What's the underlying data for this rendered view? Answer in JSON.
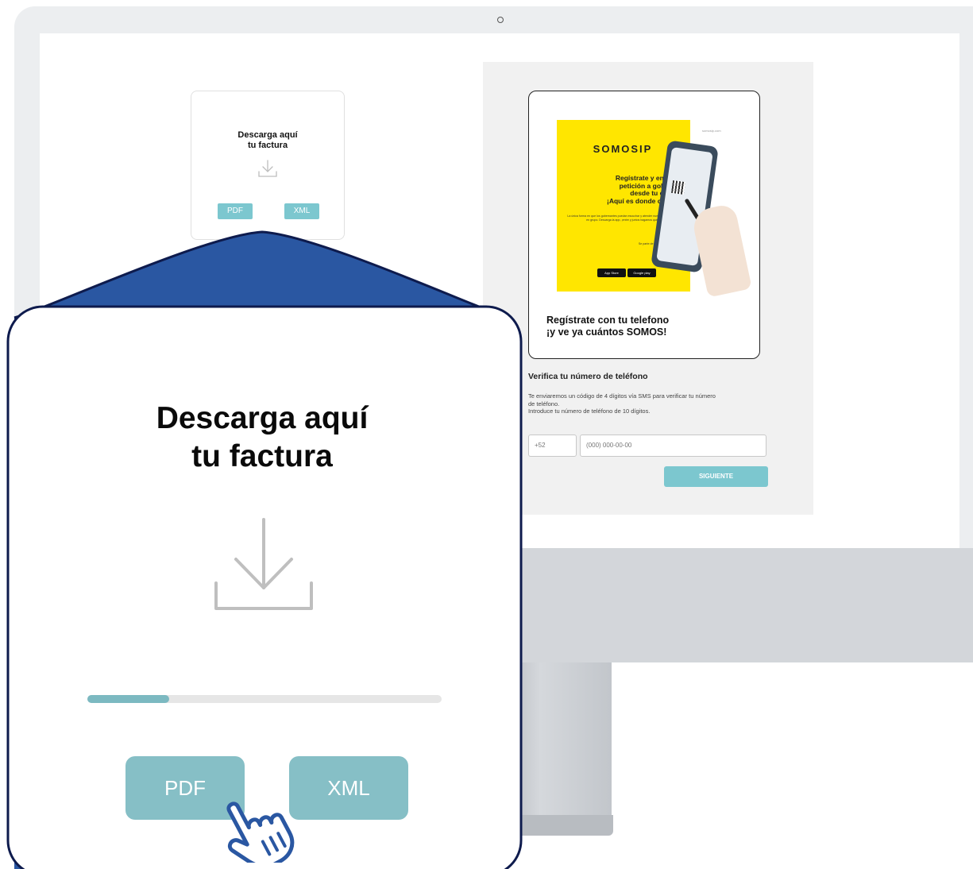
{
  "download_card": {
    "title_line1": "Descarga aquí",
    "title_line2": "tu factura",
    "pdf_label": "PDF",
    "xml_label": "XML",
    "progress_fraction": 0.23
  },
  "register_card": {
    "poster": {
      "url": "somosip.com",
      "logo": "SOMOSIP",
      "headline": [
        "Regístrate y envía tu",
        "petición a gobierno",
        "desde tu cuenta",
        "¡Aquí es donde cuenta!"
      ],
      "body": "La única forma en que los gobernantes puedan escuchar y atender nuestras peticiones es en grupo. Descarga la app, ¡entre y juntos hagamos que sean escuchados!",
      "note": "Se parte de la Gobernanza Digital",
      "download_label": "Descarga la app",
      "app_store": "App Store",
      "google_play": "Google play"
    },
    "title_line1": "Regístrate con tu telefono",
    "title_line2": "¡y ve ya cuántos SOMOS!"
  },
  "verify": {
    "title": "Verifica tu número de teléfono",
    "line1": "Te enviaremos un código de 4 dígitos vía SMS para verificar tu número",
    "line2": "de teléfono.",
    "line3": "Introduce tu número de teléfono de 10 dígitos.",
    "country_code": "+52",
    "phone_placeholder": "(000) 000-00-00",
    "next_label": "SIGUIENTE"
  },
  "colors": {
    "navy": "#0e1b4d",
    "blue": "#2a57a2",
    "teal": "#86bfc6",
    "yellow": "#ffe600"
  },
  "icons": [
    "download-icon",
    "hand-pointer-icon",
    "camera-icon"
  ]
}
